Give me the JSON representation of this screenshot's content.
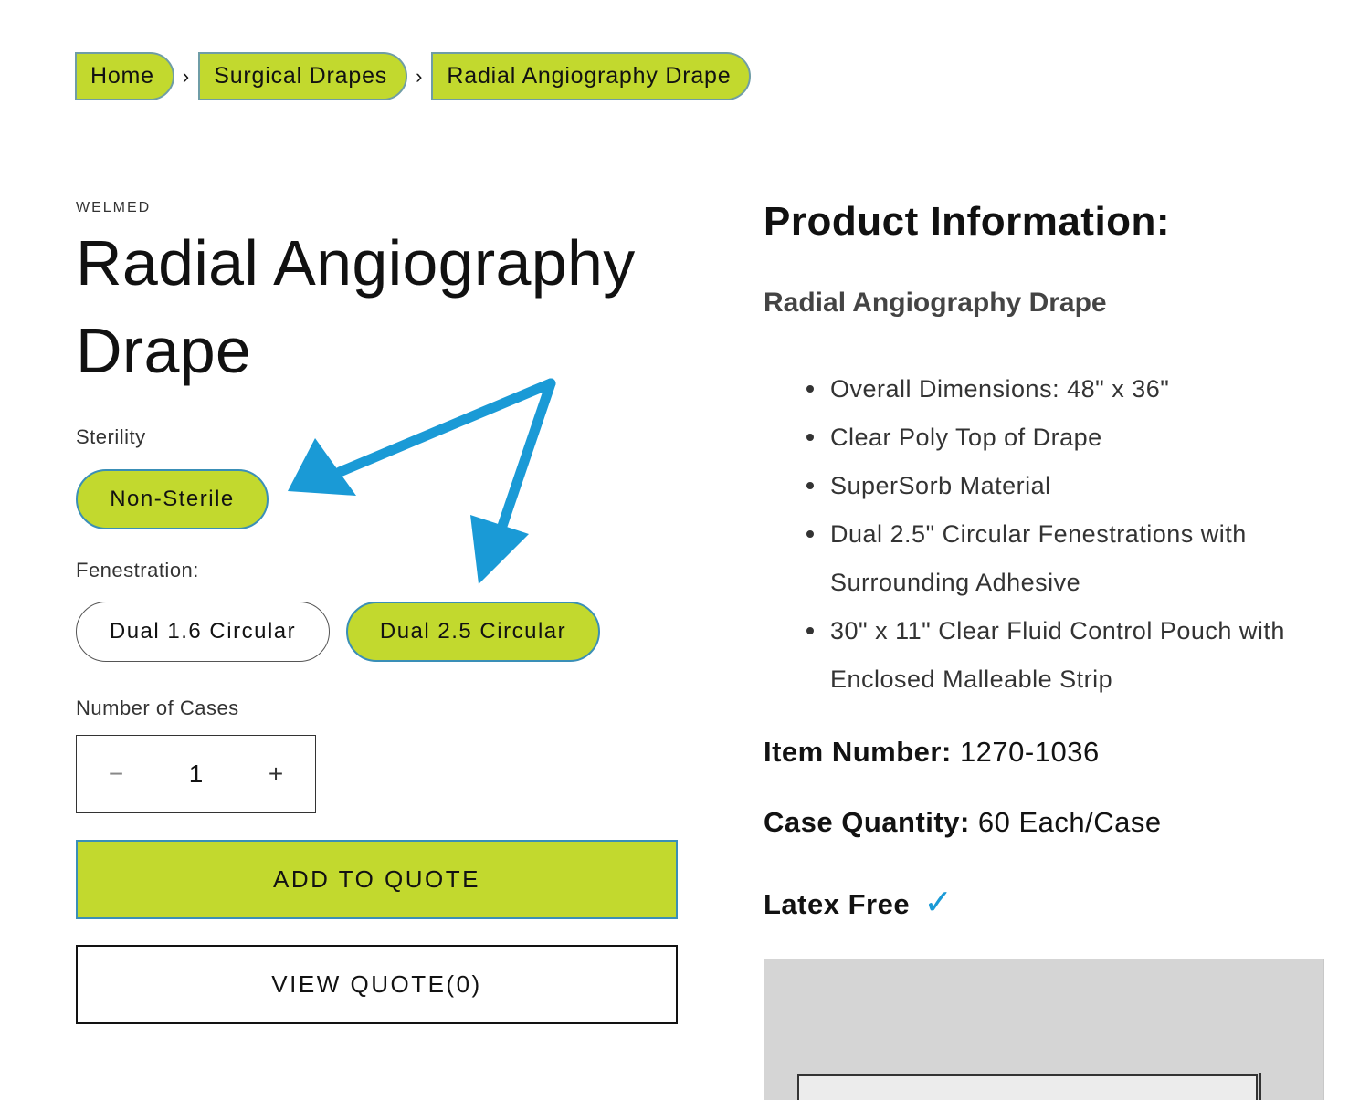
{
  "breadcrumb": {
    "items": [
      "Home",
      "Surgical Drapes",
      "Radial Angiography Drape"
    ],
    "separator": "›"
  },
  "product": {
    "vendor": "WELMED",
    "title": "Radial Angiography Drape"
  },
  "options": {
    "sterility": {
      "label": "Sterility",
      "values": [
        "Non-Sterile"
      ],
      "selected": "Non-Sterile"
    },
    "fenestration": {
      "label": "Fenestration:",
      "values": [
        "Dual 1.6 Circular",
        "Dual 2.5 Circular"
      ],
      "selected": "Dual 2.5 Circular"
    }
  },
  "quantity": {
    "label": "Number of Cases",
    "value": "1",
    "minus": "−",
    "plus": "+"
  },
  "buttons": {
    "add_to_quote": "ADD TO QUOTE",
    "view_quote": "VIEW QUOTE(0)"
  },
  "info": {
    "heading": "Product Information:",
    "subheading": "Radial Angiography Drape",
    "features": [
      "Overall Dimensions: 48\" x 36\"",
      "Clear Poly Top of Drape",
      "SuperSorb Material",
      "Dual 2.5\" Circular Fenestrations with Surrounding Adhesive",
      "30\" x 11\" Clear Fluid Control Pouch with Enclosed Malleable Strip"
    ],
    "item_number_label": "Item Number:",
    "item_number": "1270-1036",
    "case_quantity_label": "Case Quantity:",
    "case_quantity": "60 Each/Case",
    "latex_free": "Latex Free",
    "check_icon": "✓"
  },
  "colors": {
    "accent_green": "#c2d92e",
    "accent_border": "#3a8fb7",
    "arrow_blue": "#1a9ad6"
  }
}
